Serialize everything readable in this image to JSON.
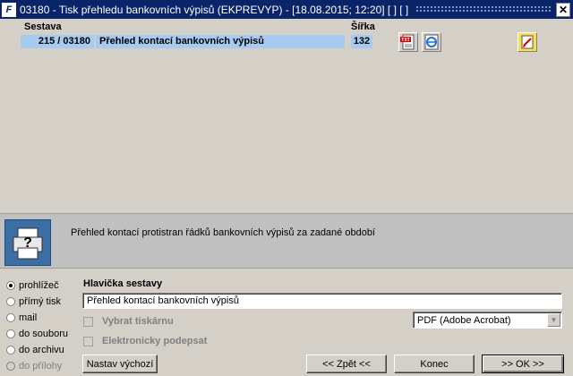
{
  "window": {
    "title": "03180 - Tisk přehledu bankovních výpisů (EKPREVYP) - [18.08.2015; 12:20]  [ ]  [ ]",
    "app_icon_text": "F",
    "close_glyph": "✕"
  },
  "list": {
    "col_sestava": "Sestava",
    "col_sirka": "Šířka",
    "row": {
      "id": "215 / 03180",
      "name": "Přehled kontací bankovních výpisů",
      "width": "132"
    }
  },
  "icons": {
    "txt": "txt-export-icon",
    "ie": "internet-explorer-icon",
    "edit": "edit-report-icon"
  },
  "info": {
    "description": "Přehled kontací protistran řádků bankovních výpisů za zadané období"
  },
  "output": {
    "options": [
      {
        "label": "prohlížeč",
        "selected": true,
        "enabled": true
      },
      {
        "label": "přímý tisk",
        "selected": false,
        "enabled": true
      },
      {
        "label": "mail",
        "selected": false,
        "enabled": true
      },
      {
        "label": "do souboru",
        "selected": false,
        "enabled": true
      },
      {
        "label": "do archivu",
        "selected": false,
        "enabled": true
      },
      {
        "label": "do přílohy",
        "selected": false,
        "enabled": false
      }
    ]
  },
  "form": {
    "header_label": "Hlavička sestavy",
    "header_value": "Přehled kontací bankovních výpisů",
    "select_printer_label": "Vybrat tiskárnu",
    "e_sign_label": "Elektronicky podepsat",
    "printer_value": "PDF (Adobe Acrobat)"
  },
  "buttons": {
    "defaults": "Nastav výchozí",
    "back": "<< Zpět <<",
    "end": "Konec",
    "ok": ">> OK >>"
  }
}
